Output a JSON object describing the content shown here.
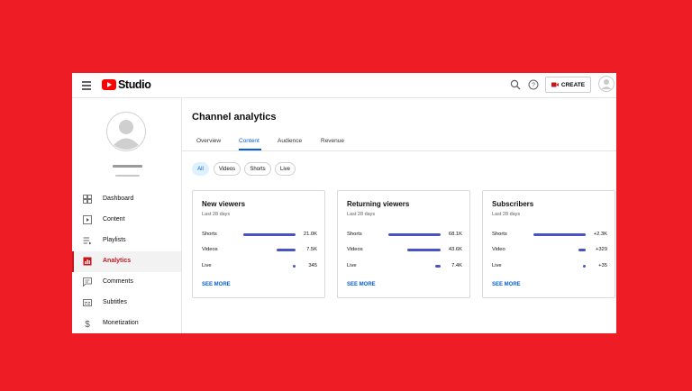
{
  "app": {
    "logo_text": "Studio",
    "create_label": "CREATE"
  },
  "sidebar": {
    "items": [
      {
        "label": "Dashboard",
        "icon": "dashboard-icon",
        "active": false
      },
      {
        "label": "Content",
        "icon": "content-icon",
        "active": false
      },
      {
        "label": "Playlists",
        "icon": "playlists-icon",
        "active": false
      },
      {
        "label": "Analytics",
        "icon": "analytics-icon",
        "active": true
      },
      {
        "label": "Comments",
        "icon": "comments-icon",
        "active": false
      },
      {
        "label": "Subtitles",
        "icon": "subtitles-icon",
        "active": false
      },
      {
        "label": "Monetization",
        "icon": "monetization-icon",
        "active": false
      }
    ]
  },
  "main": {
    "title": "Channel analytics",
    "tabs": [
      "Overview",
      "Content",
      "Audience",
      "Revenue"
    ],
    "active_tab": "Content",
    "chips": [
      "All",
      "Videos",
      "Shorts",
      "Live"
    ],
    "active_chip": "All",
    "cards": [
      {
        "title": "New viewers",
        "subtitle": "Last 28 days",
        "rows": [
          {
            "label": "Shorts",
            "value": "21.0K",
            "fraction": 1.0
          },
          {
            "label": "Videos",
            "value": "7.5K",
            "fraction": 0.36
          },
          {
            "label": "Live",
            "value": "345",
            "fraction": 0.02
          }
        ],
        "link": "SEE MORE"
      },
      {
        "title": "Returning viewers",
        "subtitle": "Last 28 days",
        "rows": [
          {
            "label": "Shorts",
            "value": "68.1K",
            "fraction": 1.0
          },
          {
            "label": "Videos",
            "value": "43.6K",
            "fraction": 0.64
          },
          {
            "label": "Live",
            "value": "7.4K",
            "fraction": 0.11
          }
        ],
        "link": "SEE MORE"
      },
      {
        "title": "Subscribers",
        "subtitle": "Last 28 days",
        "rows": [
          {
            "label": "Shorts",
            "value": "+2.3K",
            "fraction": 1.0
          },
          {
            "label": "Video",
            "value": "+329",
            "fraction": 0.14
          },
          {
            "label": "Live",
            "value": "+35",
            "fraction": 0.015
          }
        ],
        "link": "SEE MORE"
      }
    ]
  },
  "colors": {
    "background": "#ee1c25",
    "accent": "#065fd4",
    "bar": "#4a53c4",
    "active_nav": "#c4161c"
  }
}
